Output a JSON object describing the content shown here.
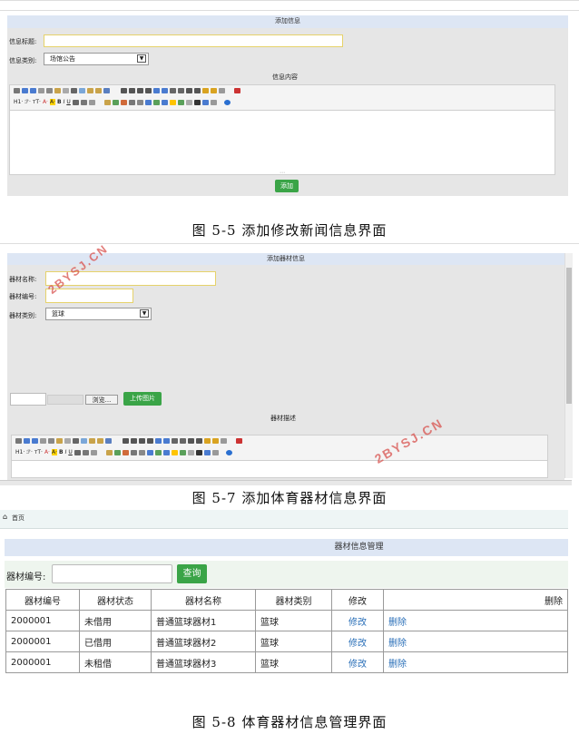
{
  "screen1": {
    "title": "添加信息",
    "title_label": "信息标题:",
    "category_label": "信息类别:",
    "category_value": "场馆公告",
    "content_label": "信息内容",
    "toolbar_row2_text": [
      "H1·",
      "ℱ·",
      "ᴛT·",
      "A·",
      "A·",
      "B",
      "I",
      "U"
    ],
    "submit_label": "添加",
    "caption": "图 5-5 添加修改新闻信息界面"
  },
  "screen2": {
    "title": "添加器材信息",
    "name_label": "器材名称:",
    "code_label": "器材编号:",
    "category_label": "器材类别:",
    "category_value": "篮球",
    "browse_label": "浏览...",
    "upload_label": "上传图片",
    "desc_label": "器材描述",
    "watermark": "2BYSJ.CN",
    "caption": "图 5-7 添加体育器材信息界面"
  },
  "screen3": {
    "home": "首页",
    "title": "器材信息管理",
    "search_label": "器材编号:",
    "search_button": "查询",
    "columns": [
      "器材编号",
      "器材状态",
      "器材名称",
      "器材类别",
      "修改",
      "删除"
    ],
    "rows": [
      {
        "code": "2000001",
        "status": "未借用",
        "name": "普通篮球器材1",
        "category": "篮球",
        "edit": "修改",
        "delete": "删除"
      },
      {
        "code": "2000001",
        "status": "已借用",
        "name": "普通篮球器材2",
        "category": "篮球",
        "edit": "修改",
        "delete": "删除"
      },
      {
        "code": "2000001",
        "status": "未租借",
        "name": "普通篮球器材3",
        "category": "篮球",
        "edit": "修改",
        "delete": "删除"
      }
    ],
    "caption": "图 5-8 体育器材信息管理界面"
  },
  "colors": {
    "accent_green": "#3aa447",
    "title_bar": "#dde6f4",
    "link": "#2a6fb8",
    "watermark": "#d9534f"
  }
}
